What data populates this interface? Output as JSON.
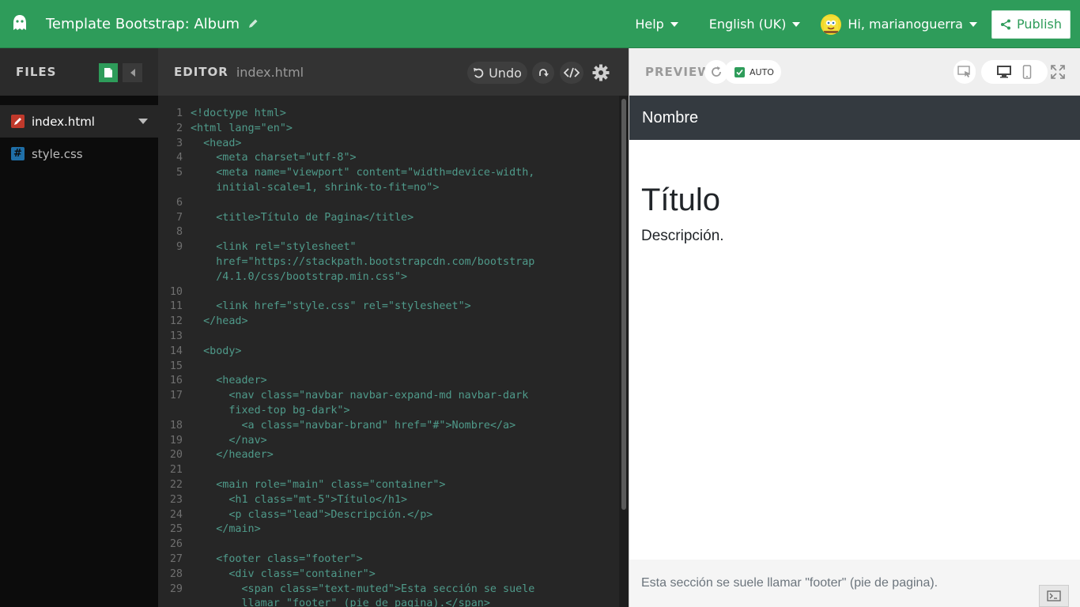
{
  "topbar": {
    "title": "Template Bootstrap: Album",
    "help": "Help",
    "language": "English (UK)",
    "user": "Hi, marianoguerra",
    "publish": "Publish",
    "accent_color": "#2e9c5a"
  },
  "files": {
    "title": "FILES",
    "items": [
      {
        "name": "index.html",
        "icon": "pencil-icon",
        "active": true
      },
      {
        "name": "style.css",
        "icon": "hash-icon",
        "active": false
      }
    ]
  },
  "editor": {
    "title": "EDITOR",
    "filename": "index.html",
    "undo": "Undo",
    "lines": [
      {
        "n": "1",
        "text": "<!doctype html>"
      },
      {
        "n": "2",
        "text": "<html lang=\"en\">"
      },
      {
        "n": "3",
        "text": "  <head>"
      },
      {
        "n": "4",
        "text": "    <meta charset=\"utf-8\">"
      },
      {
        "n": "5",
        "text": "    <meta name=\"viewport\" content=\"width=device-width,"
      },
      {
        "n": "",
        "text": "    initial-scale=1, shrink-to-fit=no\">"
      },
      {
        "n": "6",
        "text": ""
      },
      {
        "n": "7",
        "text": "    <title>Título de Pagina</title>"
      },
      {
        "n": "8",
        "text": ""
      },
      {
        "n": "9",
        "text": "    <link rel=\"stylesheet\""
      },
      {
        "n": "",
        "text": "    href=\"https://stackpath.bootstrapcdn.com/bootstrap"
      },
      {
        "n": "",
        "text": "    /4.1.0/css/bootstrap.min.css\">"
      },
      {
        "n": "10",
        "text": ""
      },
      {
        "n": "11",
        "text": "    <link href=\"style.css\" rel=\"stylesheet\">"
      },
      {
        "n": "12",
        "text": "  </head>"
      },
      {
        "n": "13",
        "text": ""
      },
      {
        "n": "14",
        "text": "  <body>"
      },
      {
        "n": "15",
        "text": ""
      },
      {
        "n": "16",
        "text": "    <header>"
      },
      {
        "n": "17",
        "text": "      <nav class=\"navbar navbar-expand-md navbar-dark"
      },
      {
        "n": "",
        "text": "      fixed-top bg-dark\">"
      },
      {
        "n": "18",
        "text": "        <a class=\"navbar-brand\" href=\"#\">Nombre</a>"
      },
      {
        "n": "19",
        "text": "      </nav>"
      },
      {
        "n": "20",
        "text": "    </header>"
      },
      {
        "n": "21",
        "text": ""
      },
      {
        "n": "22",
        "text": "    <main role=\"main\" class=\"container\">"
      },
      {
        "n": "23",
        "text": "      <h1 class=\"mt-5\">Título</h1>"
      },
      {
        "n": "24",
        "text": "      <p class=\"lead\">Descripción.</p>"
      },
      {
        "n": "25",
        "text": "    </main>"
      },
      {
        "n": "26",
        "text": ""
      },
      {
        "n": "27",
        "text": "    <footer class=\"footer\">"
      },
      {
        "n": "28",
        "text": "      <div class=\"container\">"
      },
      {
        "n": "29",
        "text": "        <span class=\"text-muted\">Esta sección se suele"
      },
      {
        "n": "",
        "text": "        llamar \"footer\" (pie de pagina).</span>"
      }
    ]
  },
  "preview": {
    "title": "PREVIEW",
    "auto_label": "AUTO",
    "navbar_brand": "Nombre",
    "heading": "Título",
    "lead": "Descripción.",
    "footer_text": "Esta sección se suele llamar \"footer\" (pie de pagina)."
  }
}
